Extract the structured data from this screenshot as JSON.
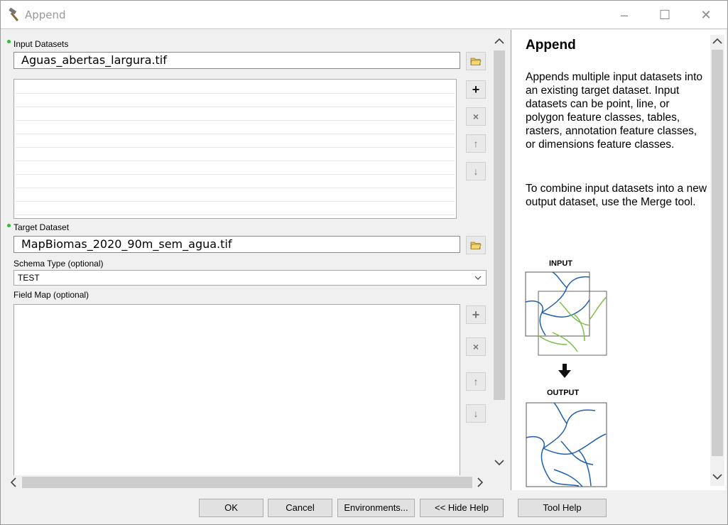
{
  "window": {
    "title": "Append",
    "minimize_glyph": "–",
    "maximize_glyph": "☐",
    "close_glyph": "✕"
  },
  "form": {
    "input_datasets_label": "Input Datasets",
    "input_datasets_value": "Aguas_abertas_largura.tif",
    "target_dataset_label": "Target Dataset",
    "target_dataset_value": "MapBiomas_2020_90m_sem_agua.tif",
    "schema_type_label": "Schema Type (optional)",
    "schema_type_value": "TEST",
    "field_map_label": "Field Map (optional)",
    "list_buttons": {
      "add": "+",
      "remove": "×",
      "up": "↑",
      "down": "↓"
    }
  },
  "help": {
    "title": "Append",
    "paragraph1": "Appends multiple input datasets into an existing target dataset. Input datasets can be point, line, or polygon feature classes, tables, rasters, annotation feature classes, or dimensions feature classes.",
    "paragraph2": "To combine input datasets into a new output dataset, use the Merge tool.",
    "diagram_input_label": "INPUT",
    "diagram_output_label": "OUTPUT"
  },
  "buttons": {
    "ok": "OK",
    "cancel": "Cancel",
    "environments": "Environments...",
    "hide_help": "<< Hide Help",
    "tool_help": "Tool Help"
  },
  "colors": {
    "blue_lines": "#1f5fae",
    "green_lines": "#7cbf4a",
    "required_dot": "#2cbf2c"
  }
}
